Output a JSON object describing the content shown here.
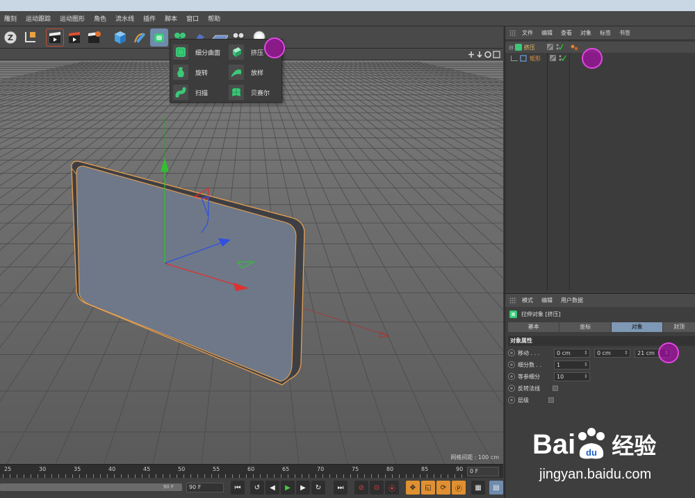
{
  "menubar": [
    "雕刻",
    "运动跟踪",
    "运动图形",
    "角色",
    "流水线",
    "插件",
    "脚本",
    "窗口",
    "帮助"
  ],
  "popup": {
    "items": [
      {
        "label": "细分曲面",
        "icon": "subdivision-surface-icon"
      },
      {
        "label": "挤压",
        "icon": "extrude-icon"
      },
      {
        "label": "旋转",
        "icon": "lathe-icon"
      },
      {
        "label": "放样",
        "icon": "loft-icon"
      },
      {
        "label": "扫描",
        "icon": "sweep-icon"
      },
      {
        "label": "贝赛尔",
        "icon": "bezier-icon"
      }
    ]
  },
  "viewport": {
    "grid_info": "网格间距 : 100 cm"
  },
  "timeline": {
    "ticks": [
      "25",
      "30",
      "35",
      "40",
      "45",
      "50",
      "55",
      "60",
      "65",
      "70",
      "75",
      "80",
      "85",
      "90"
    ],
    "current_frame": "0 F"
  },
  "playbar": {
    "slider_value": "90 F",
    "end_frame": "90 F"
  },
  "object_manager": {
    "menu": [
      "文件",
      "编辑",
      "查看",
      "对象",
      "标签",
      "书签"
    ],
    "objects": [
      {
        "name": "挤压",
        "color": "#f0c060"
      },
      {
        "name": "矩形",
        "color": "#e89a48"
      }
    ]
  },
  "attribute_manager": {
    "menu": [
      "模式",
      "编辑",
      "用户数据"
    ],
    "title": "拉伸对象 [挤压]",
    "tabs": [
      "基本",
      "坐标",
      "对象",
      "封顶"
    ],
    "active_tab": "对象",
    "section": "对象属性",
    "fields": {
      "move": {
        "label": "移动 . . .",
        "x": "0 cm",
        "y": "0 cm",
        "z": "21 cm"
      },
      "subdivisions": {
        "label": "细分数 . .",
        "value": "1"
      },
      "iso": {
        "label": "等参细分",
        "value": "10"
      },
      "flip_normals": {
        "label": "反转法线"
      },
      "hierarchical": {
        "label": "层级"
      }
    }
  },
  "watermark": {
    "brand": "Bai",
    "brand_suffix": "经验",
    "url": "jingyan.baidu.com"
  },
  "colors": {
    "accent": "#7e98b5",
    "highlight": "#e048e0",
    "selection": "#e8a050"
  }
}
